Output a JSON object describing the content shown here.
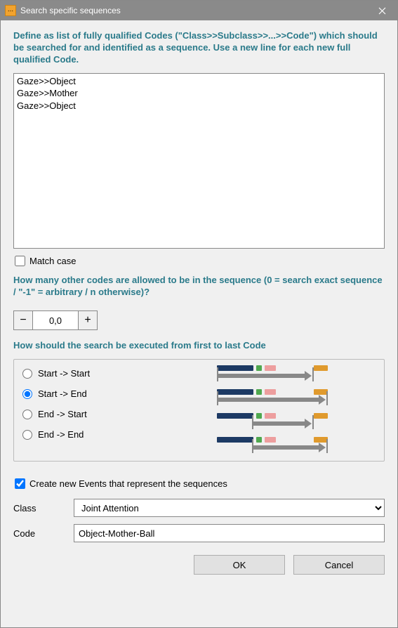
{
  "window": {
    "title": "Search specific sequences"
  },
  "instruction1": "Define as list of fully qualified Codes (\"Class>>Subclass>>...>>Code\") which should be searched for and identified as a sequence. Use a new line for each new full qualified Code.",
  "codes_text": "Gaze>>Object\nGaze>>Mother\nGaze>>Object",
  "match_case": {
    "label": "Match case",
    "checked": false
  },
  "instruction2": "How many other codes are allowed to be in the sequence (0 = search exact sequence / \"-1\" = arbitrary / n otherwise)?",
  "stepper": {
    "value": "0,0"
  },
  "instruction3": "How should the search be executed from first to last Code",
  "radio": {
    "options": [
      {
        "label": "Start -> Start",
        "value": "ss"
      },
      {
        "label": "Start -> End",
        "value": "se"
      },
      {
        "label": "End -> Start",
        "value": "es"
      },
      {
        "label": "End -> End",
        "value": "ee"
      }
    ],
    "selected": "se"
  },
  "create_events": {
    "label": "Create new Events that represent the sequences",
    "checked": true
  },
  "class_field": {
    "label": "Class",
    "value": "Joint Attention"
  },
  "code_field": {
    "label": "Code",
    "value": "Object-Mother-Ball"
  },
  "buttons": {
    "ok": "OK",
    "cancel": "Cancel"
  }
}
